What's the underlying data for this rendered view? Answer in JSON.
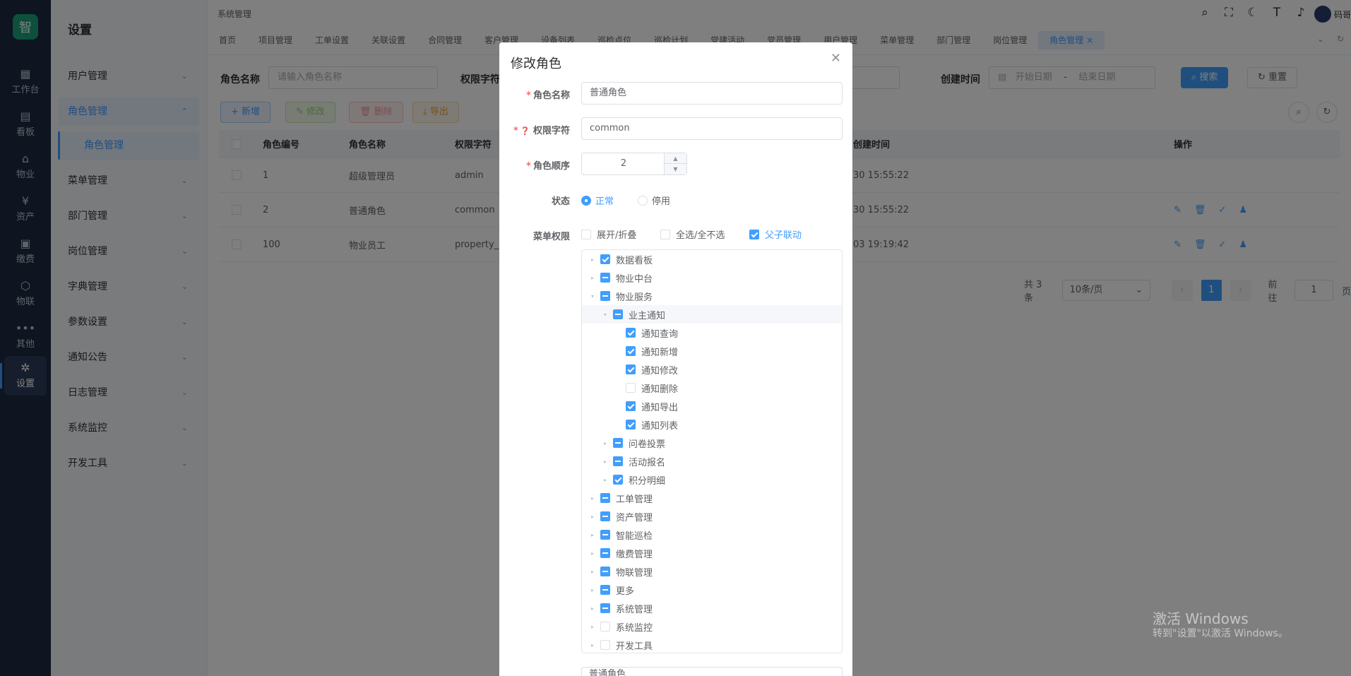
{
  "rail": {
    "logo": "智",
    "items": [
      {
        "label": "工作台",
        "icon": "▦"
      },
      {
        "label": "看板",
        "icon": "▤"
      },
      {
        "label": "物业",
        "icon": "⌂"
      },
      {
        "label": "资产",
        "icon": "¥"
      },
      {
        "label": "缴费",
        "icon": "▣"
      },
      {
        "label": "物联",
        "icon": "⬡"
      },
      {
        "label": "其他",
        "icon": "•••"
      },
      {
        "label": "设置",
        "icon": "✲"
      }
    ]
  },
  "sidebar": {
    "title": "设置",
    "items": [
      {
        "label": "用户管理"
      },
      {
        "label": "角色管理"
      },
      {
        "label": "菜单管理"
      },
      {
        "label": "部门管理"
      },
      {
        "label": "岗位管理"
      },
      {
        "label": "字典管理"
      },
      {
        "label": "参数设置"
      },
      {
        "label": "通知公告"
      },
      {
        "label": "日志管理"
      },
      {
        "label": "系统监控"
      },
      {
        "label": "开发工具"
      }
    ],
    "sub": "角色管理"
  },
  "topbar": {
    "crumb": "系统管理",
    "user": "码哥",
    "tabs": [
      "首页",
      "项目管理",
      "工单设置",
      "关联设置",
      "合同管理",
      "客户管理",
      "设备列表",
      "巡检点位",
      "巡检计划",
      "党建活动",
      "党员管理",
      "用户管理",
      "菜单管理",
      "部门管理",
      "岗位管理",
      "角色管理"
    ],
    "active_tab_close": "×"
  },
  "search": {
    "role_name_label": "角色名称",
    "role_name_placeholder": "请输入角色名称",
    "perm_label": "权限字符",
    "created_label": "创建时间",
    "start_placeholder": "开始日期",
    "range_sep": "-",
    "end_placeholder": "结束日期",
    "search_btn": "搜索",
    "reset_btn": "重置"
  },
  "toolbar": {
    "add": "+ 新增",
    "edit": "修改",
    "delete": "删除",
    "export": "导出"
  },
  "table": {
    "headers": [
      "角色编号",
      "角色名称",
      "权限字符",
      "创建时间",
      "操作"
    ],
    "rows": [
      {
        "id": "1",
        "name": "超级管理员",
        "key": "admin",
        "time": "30 15:55:22"
      },
      {
        "id": "2",
        "name": "普通角色",
        "key": "common",
        "time": "30 15:55:22"
      },
      {
        "id": "100",
        "name": "物业员工",
        "key": "property_",
        "time": "03 19:19:42"
      }
    ]
  },
  "pager": {
    "total": "共 3 条",
    "size": "10条/页",
    "current": "1",
    "goto_label": "前往",
    "goto_value": "1",
    "page_suffix": "页"
  },
  "dialog": {
    "title": "修改角色",
    "role_name_label": "角色名称",
    "role_name_value": "普通角色",
    "perm_label": "权限字符",
    "perm_value": "common",
    "order_label": "角色顺序",
    "order_value": "2",
    "status_label": "状态",
    "status_normal": "正常",
    "status_disabled": "停用",
    "menu_label": "菜单权限",
    "opt_expand": "展开/折叠",
    "opt_all": "全选/全不选",
    "opt_link": "父子联动",
    "tree": [
      {
        "label": "数据看板",
        "level": 0,
        "state": "checked",
        "arrow": "▸"
      },
      {
        "label": "物业中台",
        "level": 0,
        "state": "partial",
        "arrow": "▸"
      },
      {
        "label": "物业服务",
        "level": 0,
        "state": "partial",
        "arrow": "▾"
      },
      {
        "label": "业主通知",
        "level": 1,
        "state": "partial",
        "arrow": "▾"
      },
      {
        "label": "通知查询",
        "level": 2,
        "state": "checked",
        "arrow": ""
      },
      {
        "label": "通知新增",
        "level": 2,
        "state": "checked",
        "arrow": ""
      },
      {
        "label": "通知修改",
        "level": 2,
        "state": "checked",
        "arrow": ""
      },
      {
        "label": "通知删除",
        "level": 2,
        "state": "unchecked",
        "arrow": ""
      },
      {
        "label": "通知导出",
        "level": 2,
        "state": "checked",
        "arrow": ""
      },
      {
        "label": "通知列表",
        "level": 2,
        "state": "checked",
        "arrow": ""
      },
      {
        "label": "问卷投票",
        "level": 1,
        "state": "partial",
        "arrow": "▸"
      },
      {
        "label": "活动报名",
        "level": 1,
        "state": "partial",
        "arrow": "▸"
      },
      {
        "label": "积分明细",
        "level": 1,
        "state": "checked",
        "arrow": "▸"
      },
      {
        "label": "工单管理",
        "level": 0,
        "state": "partial",
        "arrow": "▸"
      },
      {
        "label": "资产管理",
        "level": 0,
        "state": "partial",
        "arrow": "▸"
      },
      {
        "label": "智能巡检",
        "level": 0,
        "state": "partial",
        "arrow": "▸"
      },
      {
        "label": "缴费管理",
        "level": 0,
        "state": "partial",
        "arrow": "▸"
      },
      {
        "label": "物联管理",
        "level": 0,
        "state": "partial",
        "arrow": "▸"
      },
      {
        "label": "更多",
        "level": 0,
        "state": "partial",
        "arrow": "▸"
      },
      {
        "label": "系统管理",
        "level": 0,
        "state": "partial",
        "arrow": "▸"
      },
      {
        "label": "系统监控",
        "level": 0,
        "state": "unchecked",
        "arrow": "▸"
      },
      {
        "label": "开发工具",
        "level": 0,
        "state": "unchecked",
        "arrow": "▸"
      }
    ],
    "remark_peek": "普通角色"
  },
  "watermark": {
    "line1": "激活 Windows",
    "line2": "转到\"设置\"以激活 Windows。"
  },
  "colors": {
    "primary": "#409eff",
    "rail_bg": "#1d2841",
    "logo": "#1aa37a"
  }
}
